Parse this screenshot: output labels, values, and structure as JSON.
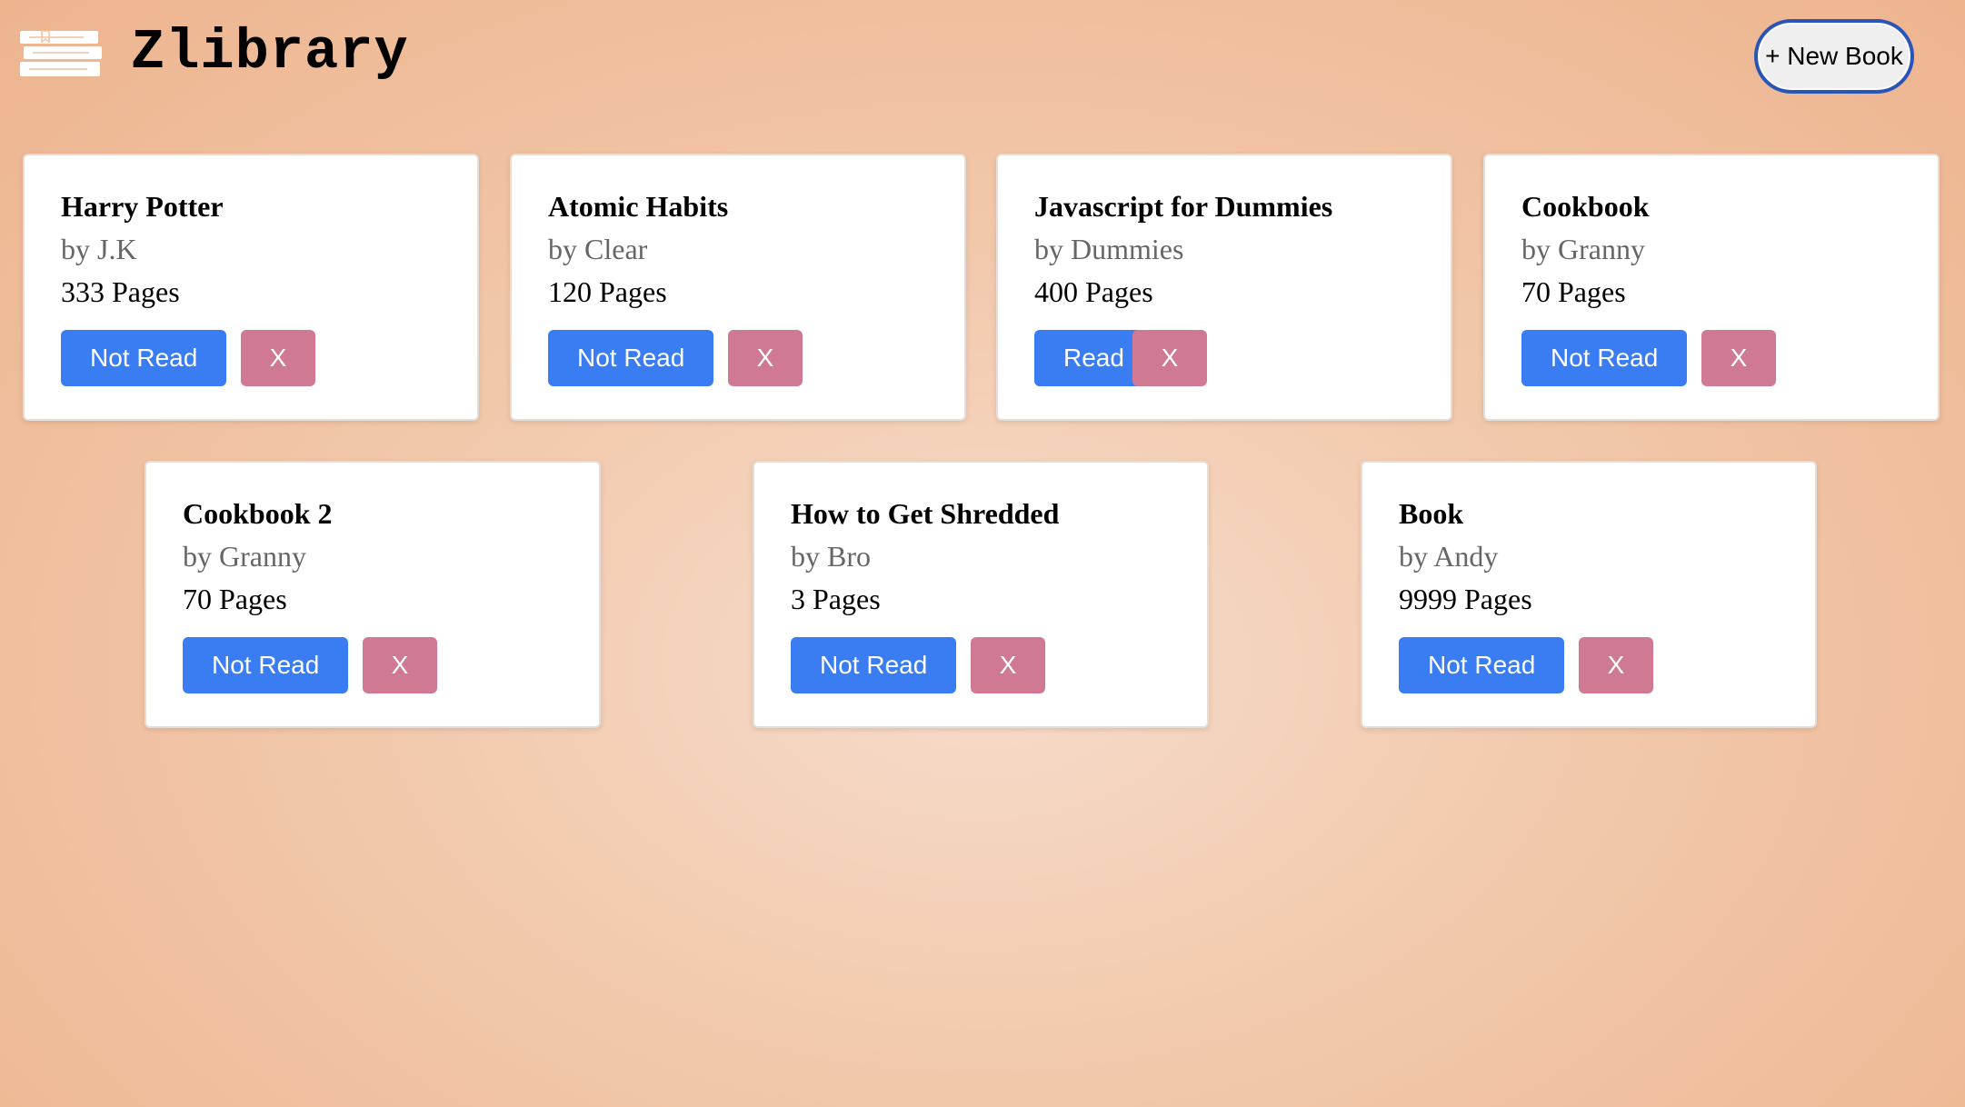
{
  "app": {
    "title": "Zlibrary",
    "logo_icon": "books-stack-icon",
    "new_book_label": "+ New Book"
  },
  "colors": {
    "status_button": "#3a7cf2",
    "delete_button": "#cf7a92",
    "new_book_border": "#2a55b8",
    "background": "#f2c8ab"
  },
  "books": [
    {
      "title": "Harry Potter",
      "author": "by J.K",
      "pages": "333 Pages",
      "status": "Not Read",
      "delete": "X"
    },
    {
      "title": "Atomic Habits",
      "author": "by Clear",
      "pages": "120 Pages",
      "status": "Not Read",
      "delete": "X"
    },
    {
      "title": "Javascript for Dummies",
      "author": "by Dummies",
      "pages": "400 Pages",
      "status": "Read",
      "delete": "X"
    },
    {
      "title": "Cookbook",
      "author": "by Granny",
      "pages": "70 Pages",
      "status": "Not Read",
      "delete": "X"
    },
    {
      "title": "Cookbook 2",
      "author": "by Granny",
      "pages": "70 Pages",
      "status": "Not Read",
      "delete": "X"
    },
    {
      "title": "How to Get Shredded",
      "author": "by Bro",
      "pages": "3 Pages",
      "status": "Not Read",
      "delete": "X"
    },
    {
      "title": "Book",
      "author": "by Andy",
      "pages": "9999 Pages",
      "status": "Not Read",
      "delete": "X"
    }
  ]
}
